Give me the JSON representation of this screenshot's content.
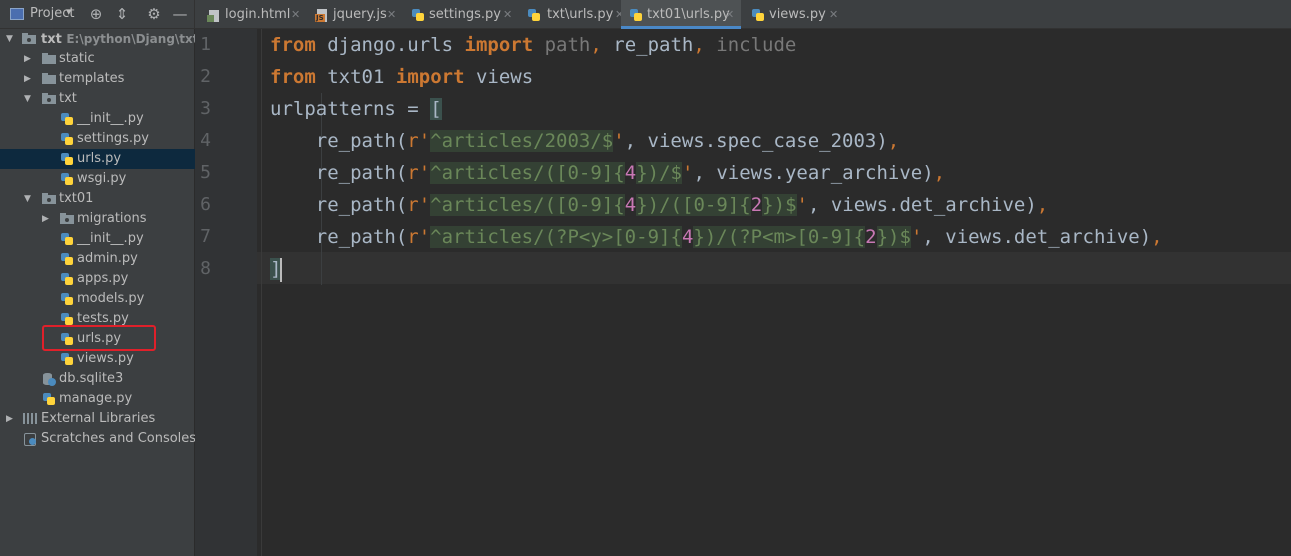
{
  "toolbar": {
    "project_label": "Project",
    "icons": [
      "target-icon",
      "collapse-icon",
      "gear-icon",
      "minimize-icon"
    ]
  },
  "tabs": [
    {
      "label": "login.html",
      "icon": "html-file-icon"
    },
    {
      "label": "jquery.js",
      "icon": "js-file-icon"
    },
    {
      "label": "settings.py",
      "icon": "python-file-icon"
    },
    {
      "label": "txt\\urls.py",
      "icon": "python-file-icon"
    },
    {
      "label": "txt01\\urls.py",
      "icon": "python-file-icon",
      "active": true
    },
    {
      "label": "views.py",
      "icon": "python-file-icon"
    }
  ],
  "tree": {
    "root": {
      "label": "txt",
      "path": "E:\\python\\Djang\\txt"
    },
    "items": [
      {
        "label": "static"
      },
      {
        "label": "templates"
      },
      {
        "label": "txt"
      },
      {
        "label": "__init__.py"
      },
      {
        "label": "settings.py"
      },
      {
        "label": "urls.py",
        "selected": true
      },
      {
        "label": "wsgi.py"
      },
      {
        "label": "txt01"
      },
      {
        "label": "migrations"
      },
      {
        "label": "__init__.py"
      },
      {
        "label": "admin.py"
      },
      {
        "label": "apps.py"
      },
      {
        "label": "models.py"
      },
      {
        "label": "tests.py"
      },
      {
        "label": "urls.py",
        "highlighted": true
      },
      {
        "label": "views.py"
      },
      {
        "label": "db.sqlite3"
      },
      {
        "label": "manage.py"
      },
      {
        "label": "External Libraries"
      },
      {
        "label": "Scratches and Consoles"
      }
    ]
  },
  "editor": {
    "line_numbers": [
      "1",
      "2",
      "3",
      "4",
      "5",
      "6",
      "7",
      "8"
    ],
    "current_line": 8,
    "code": [
      "from django.urls import path, re_path, include",
      "from txt01 import views",
      "urlpatterns = [",
      "    re_path(r'^articles/2003/$', views.spec_case_2003),",
      "    re_path(r'^articles/([0-9]{4})/$', views.year_archive),",
      "    re_path(r'^articles/([0-9]{4})/([0-9]{2})$', views.det_archive),",
      "    re_path(r'^articles/(?P<y>[0-9]{4})/(?P<m>[0-9]{2})$', views.det_archive),",
      "]"
    ]
  },
  "colors": {
    "keyword": "#cc7832",
    "identifier": "#a9b7c6",
    "string": "#6a8759",
    "number": "#c878b4",
    "unused_import": "#787878",
    "selection": "#0d293e",
    "annotation_box": "#e0202a"
  }
}
